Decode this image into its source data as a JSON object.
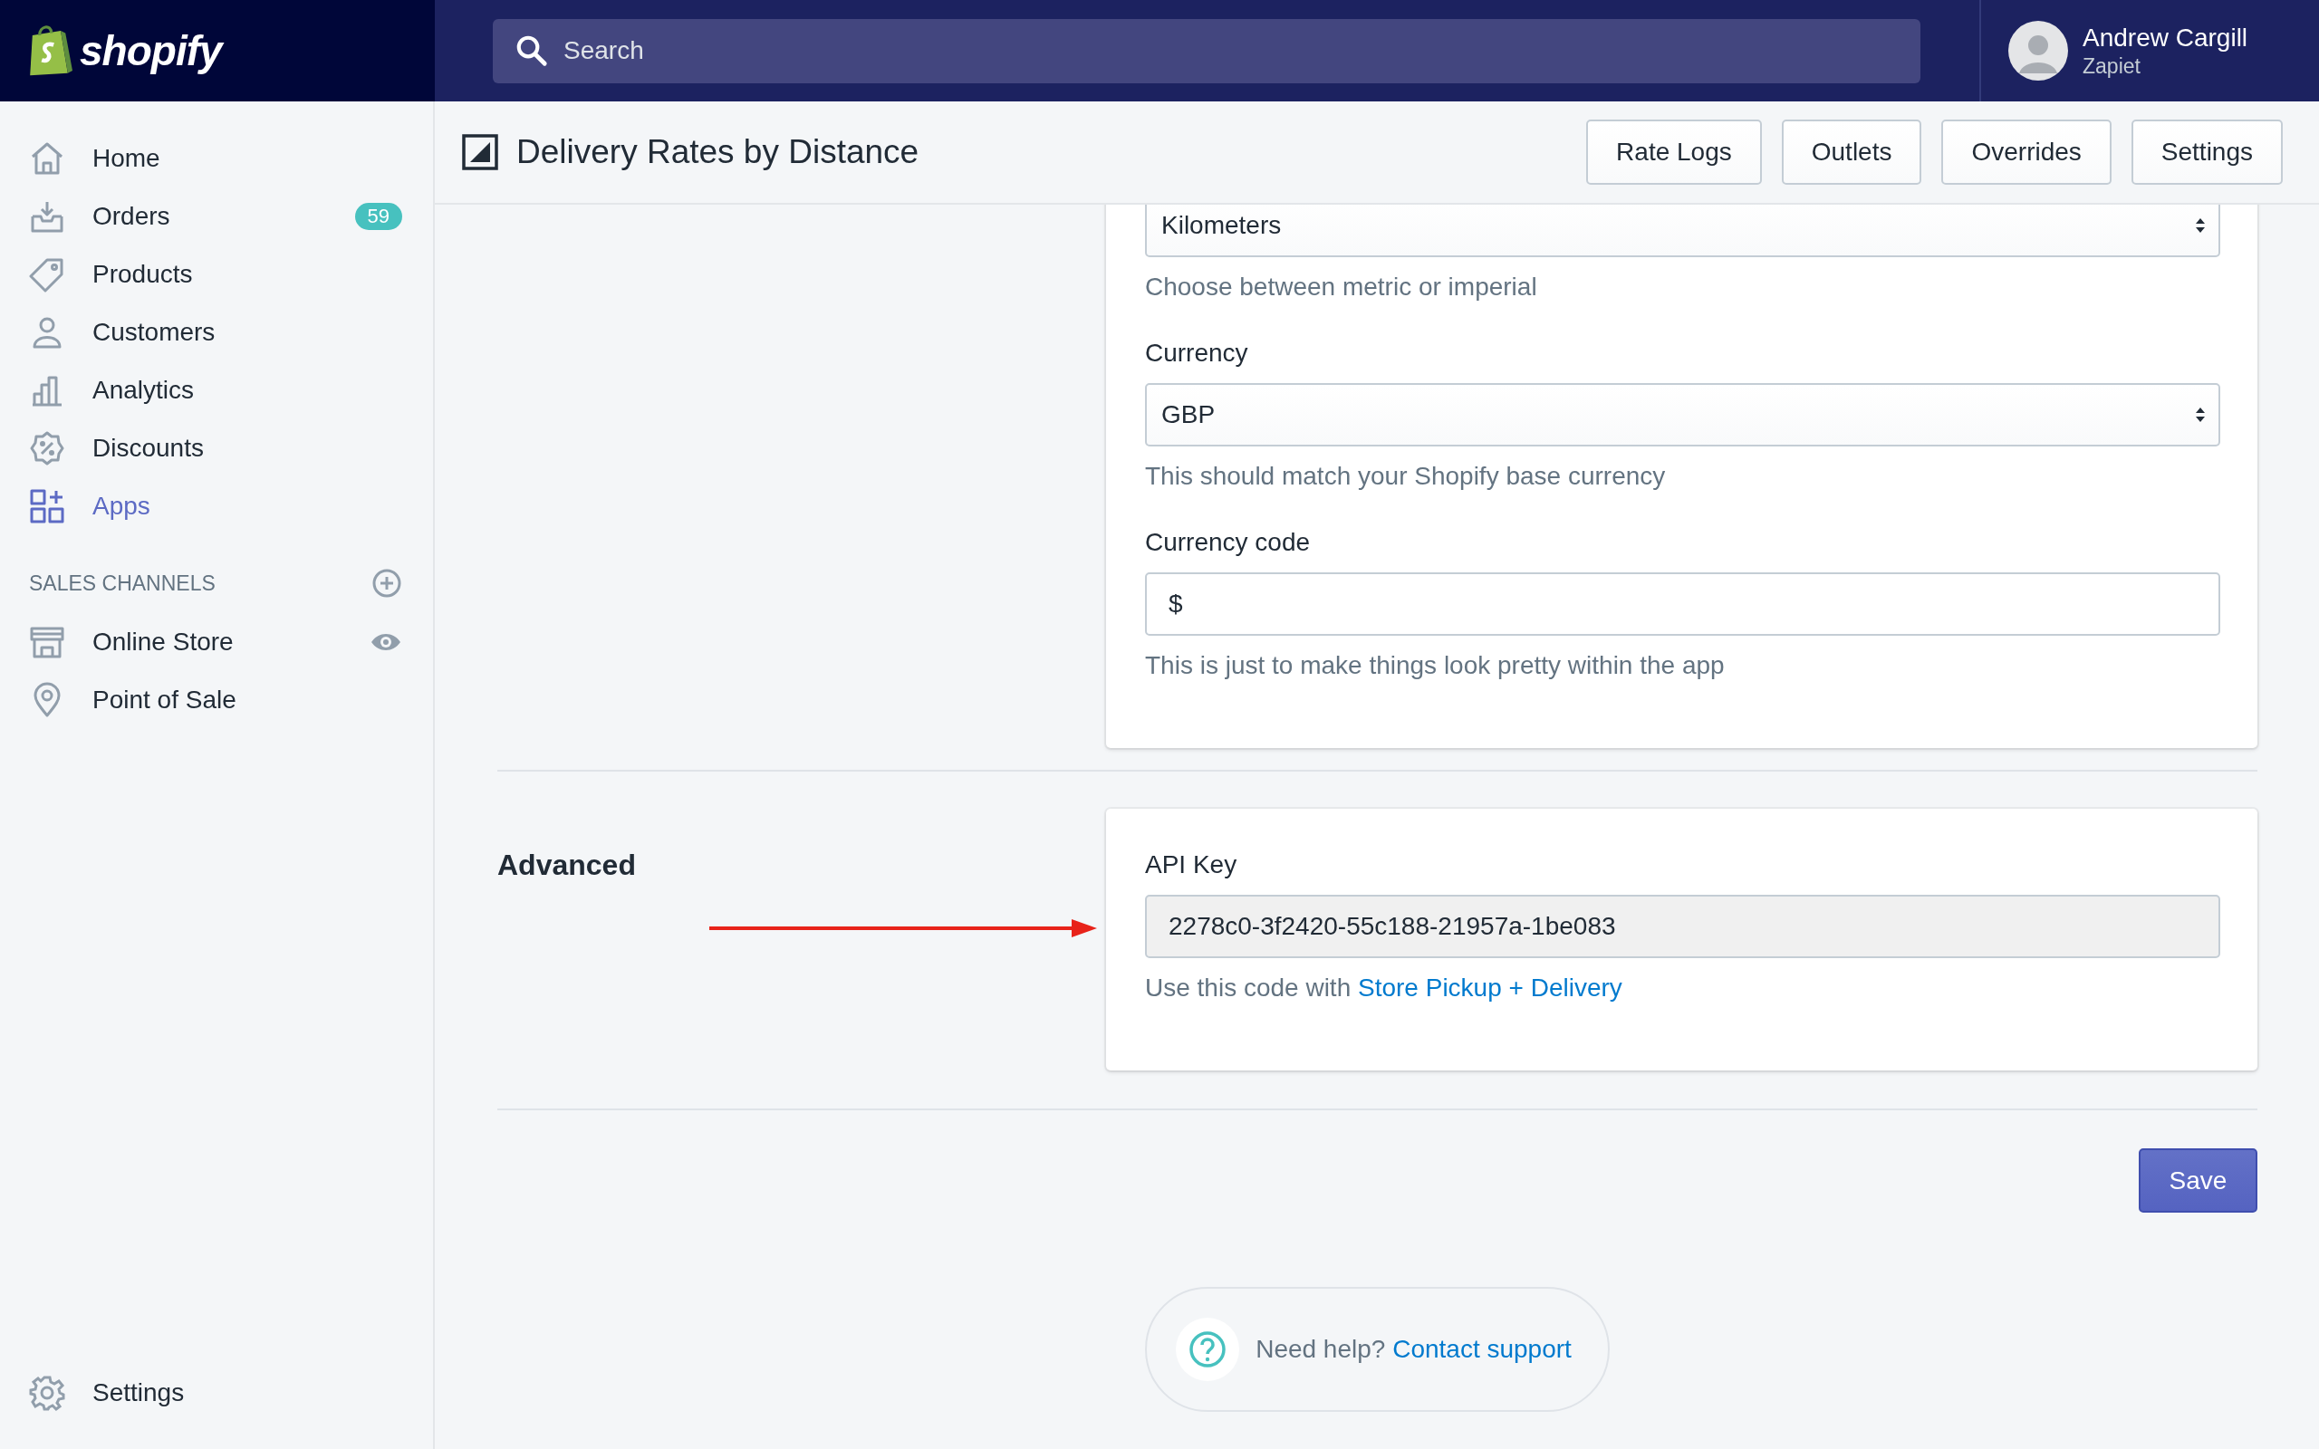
{
  "top_bar": {
    "logo": "shopify",
    "search": {
      "placeholder": "Search"
    },
    "user": {
      "name": "Andrew Cargill",
      "store": "Zapiet"
    }
  },
  "sidebar": {
    "items": [
      {
        "label": "Home",
        "selected": false
      },
      {
        "label": "Orders",
        "selected": false,
        "badge": "59"
      },
      {
        "label": "Products",
        "selected": false
      },
      {
        "label": "Customers",
        "selected": false
      },
      {
        "label": "Analytics",
        "selected": false
      },
      {
        "label": "Discounts",
        "selected": false
      },
      {
        "label": "Apps",
        "selected": true
      }
    ],
    "sales_channels": {
      "title": "SALES CHANNELS",
      "items": [
        {
          "label": "Online Store",
          "view_toggle": true
        },
        {
          "label": "Point of Sale",
          "view_toggle": false
        }
      ]
    },
    "settings": {
      "label": "Settings"
    }
  },
  "page": {
    "title": "Delivery Rates by Distance",
    "actions": [
      "Rate Logs",
      "Outlets",
      "Overrides",
      "Settings"
    ]
  },
  "sections": [
    {
      "fields": [
        {
          "kind": "select",
          "value": "Kilometers",
          "help": "Choose between metric or imperial"
        },
        {
          "kind": "select",
          "label": "Currency",
          "value": "GBP",
          "help": "This should match your Shopify base currency"
        },
        {
          "kind": "input",
          "label": "Currency code",
          "value": "$",
          "help": "This is just to make things look pretty within the app"
        }
      ]
    },
    {
      "title": "Advanced",
      "pointer_arrow": true,
      "fields": [
        {
          "kind": "readonly",
          "label": "API Key",
          "value": "2278c0-3f2420-55c188-21957a-1be083",
          "help": "Use this code with",
          "help_link": "Store Pickup + Delivery"
        }
      ]
    }
  ],
  "save_button": "Save",
  "help": {
    "text": "Need help?",
    "link": "Contact support"
  }
}
